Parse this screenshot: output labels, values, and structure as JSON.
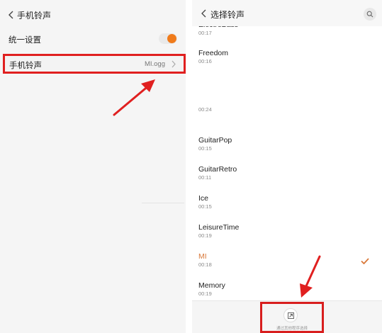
{
  "colors": {
    "accent_orange": "#f07b1b",
    "highlight_red": "#e02020",
    "selected_text": "#d9793a"
  },
  "left_screen": {
    "title": "手机铃声",
    "unified_setting": {
      "label": "统一设置",
      "enabled": true
    },
    "ringtone_row": {
      "label": "手机铃声",
      "value": "MI.ogg"
    }
  },
  "right_screen": {
    "title": "选择铃声",
    "items": [
      {
        "name": "ElectroBass",
        "duration": "00:17"
      },
      {
        "name": "Freedom",
        "duration": "00:16"
      },
      {
        "name": "",
        "duration": "00:24"
      },
      {
        "name": "GuitarPop",
        "duration": "00:15"
      },
      {
        "name": "GuitarRetro",
        "duration": "00:11"
      },
      {
        "name": "Ice",
        "duration": "00:15"
      },
      {
        "name": "LeisureTime",
        "duration": "00:19"
      },
      {
        "name": "MI",
        "duration": "00:18",
        "selected": true
      },
      {
        "name": "Memory",
        "duration": "00:19"
      }
    ],
    "external_picker_label": "通过其他程序选择"
  }
}
